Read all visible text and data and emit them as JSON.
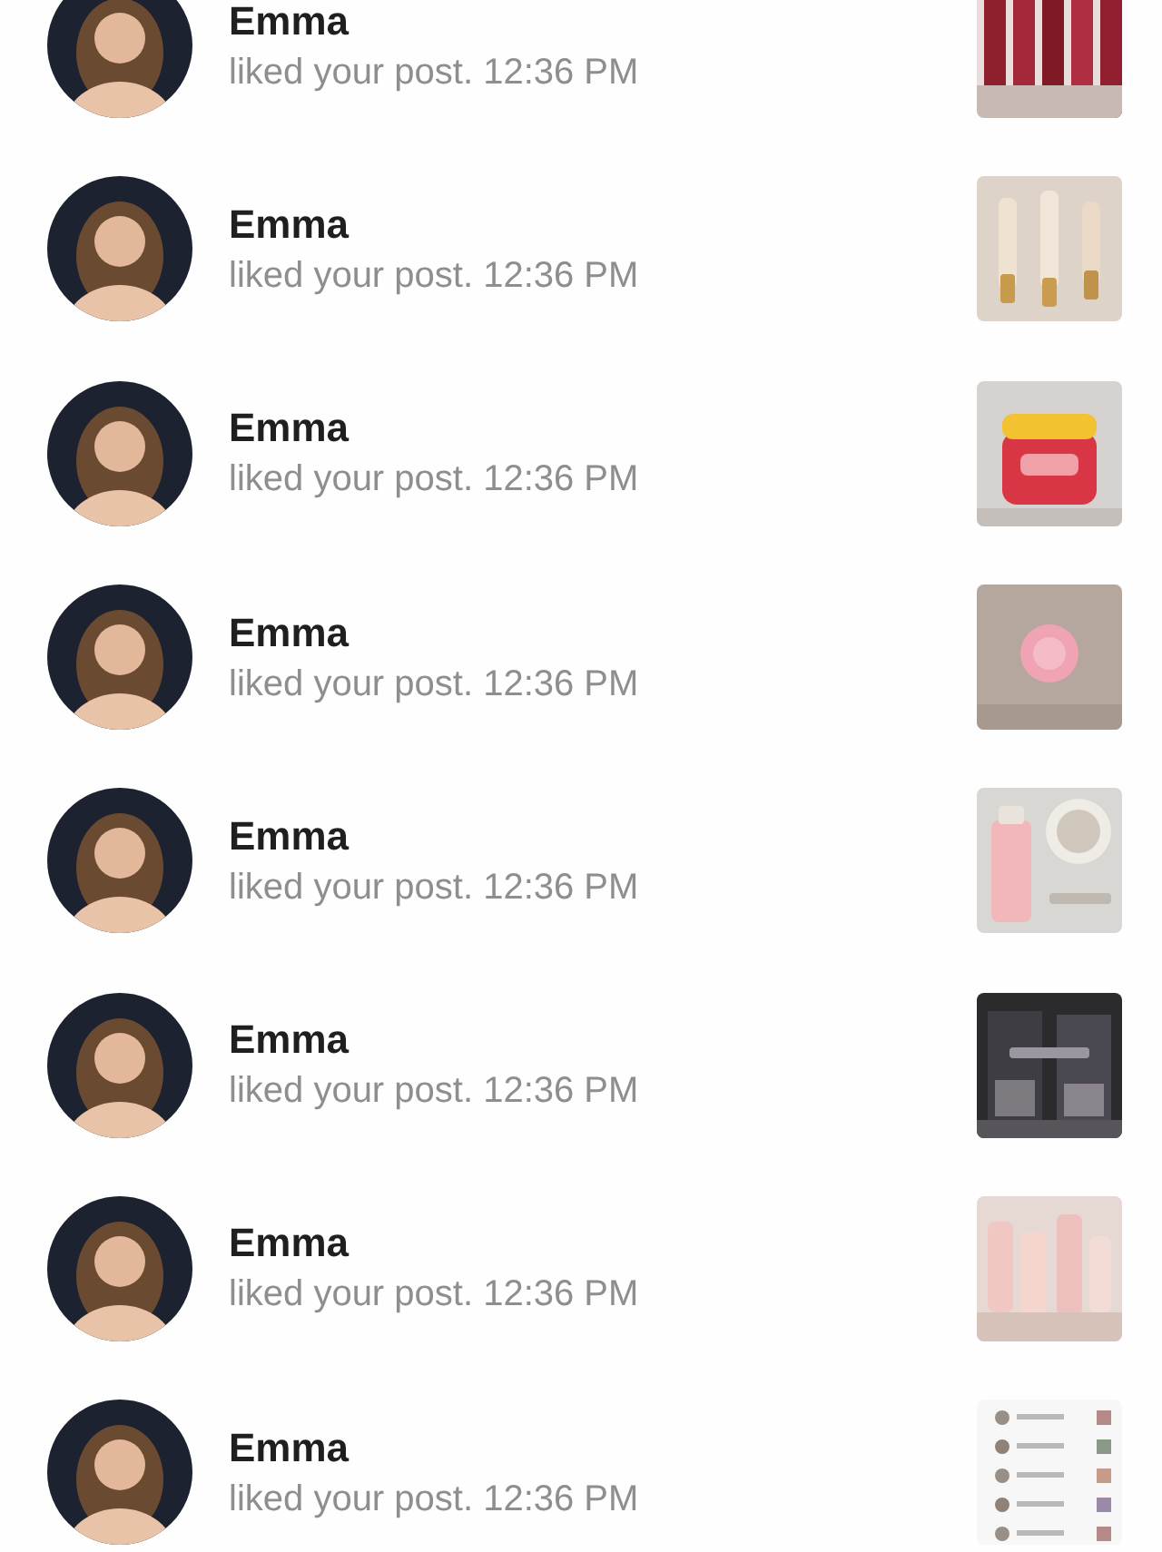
{
  "notifications": [
    {
      "name": "Emma",
      "message": "liked your post. 12:36 PM"
    },
    {
      "name": "Emma",
      "message": "liked your post. 12:36 PM"
    },
    {
      "name": "Emma",
      "message": "liked your post. 12:36 PM"
    },
    {
      "name": "Emma",
      "message": "liked your post. 12:36 PM"
    },
    {
      "name": "Emma",
      "message": "liked your post. 12:36 PM"
    },
    {
      "name": "Emma",
      "message": "liked your post. 12:36 PM"
    },
    {
      "name": "Emma",
      "message": "liked your post. 12:36 PM"
    },
    {
      "name": "Emma",
      "message": "liked your post. 12:36 PM"
    }
  ]
}
